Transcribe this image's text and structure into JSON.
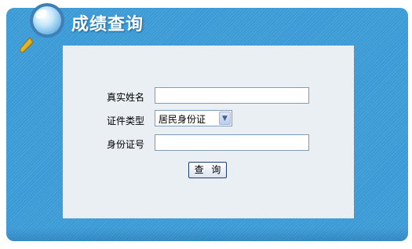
{
  "header": {
    "title": "成绩查询"
  },
  "form": {
    "name_label": "真实姓名",
    "name_value": "",
    "id_type_label": "证件类型",
    "id_type_selected": "居民身份证",
    "id_number_label": "身份证号",
    "id_number_value": "",
    "submit_label": "查 询"
  },
  "icons": {
    "header_icon": "magnifier-icon",
    "dropdown_icon": "chevron-down-icon"
  },
  "colors": {
    "panel": "#3a9ad6",
    "content_bg": "#e9eff3",
    "input_border": "#7f9db9"
  }
}
